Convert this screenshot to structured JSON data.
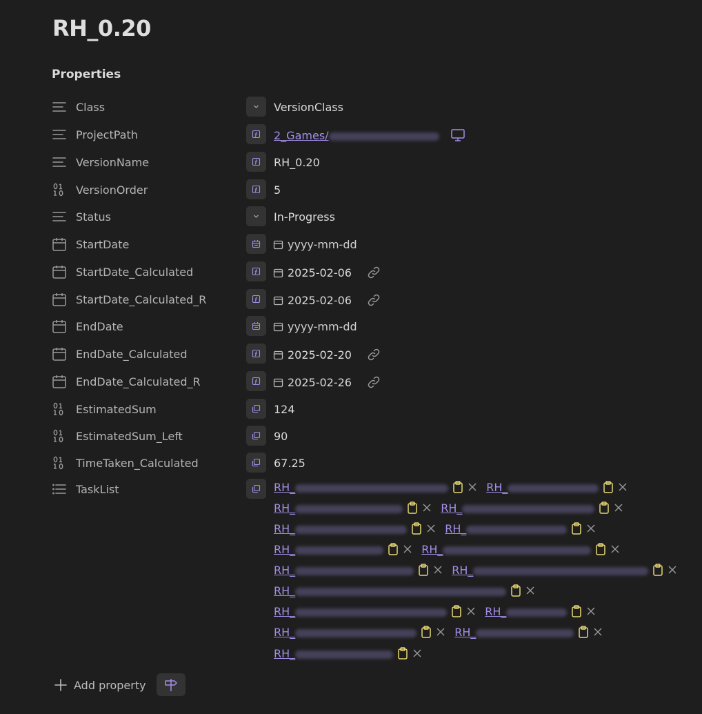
{
  "page": {
    "title": "RH_0.20"
  },
  "properties_heading": "Properties",
  "rows": [
    {
      "name": "Class",
      "value": "VersionClass"
    },
    {
      "name": "ProjectPath",
      "link_prefix": "2_Games/"
    },
    {
      "name": "VersionName",
      "value": "RH_0.20"
    },
    {
      "name": "VersionOrder",
      "value": "5"
    },
    {
      "name": "Status",
      "value": "In-Progress"
    },
    {
      "name": "StartDate",
      "value": "yyyy-mm-dd"
    },
    {
      "name": "StartDate_Calculated",
      "value": "2025-02-06"
    },
    {
      "name": "StartDate_Calculated_R",
      "value": "2025-02-06"
    },
    {
      "name": "EndDate",
      "value": "yyyy-mm-dd"
    },
    {
      "name": "EndDate_Calculated",
      "value": "2025-02-20"
    },
    {
      "name": "EndDate_Calculated_R",
      "value": "2025-02-26"
    },
    {
      "name": "EstimatedSum",
      "value": "124"
    },
    {
      "name": "EstimatedSum_Left",
      "value": "90"
    },
    {
      "name": "TimeTaken_Calculated",
      "value": "67.25"
    },
    {
      "name": "TaskList"
    }
  ],
  "task_prefix": "RH_",
  "add_property_label": "Add property",
  "colors": {
    "background": "#1e1e1e",
    "link": "#a48ee8",
    "clipboard": "#e6d774",
    "button_bg": "#333333"
  },
  "icons": {
    "text_type": "lines-icon",
    "number_type": "binary-icon",
    "date_type": "calendar-icon",
    "list_type": "list-icon",
    "dropdown": "chevron-down-icon",
    "formula": "function-icon",
    "date_picker": "calendar-small-icon",
    "link": "link-icon",
    "clipboard": "clipboard-icon",
    "remove": "close-icon",
    "add": "plus-icon",
    "signpost": "signpost-icon",
    "monitor": "monitor-icon"
  }
}
